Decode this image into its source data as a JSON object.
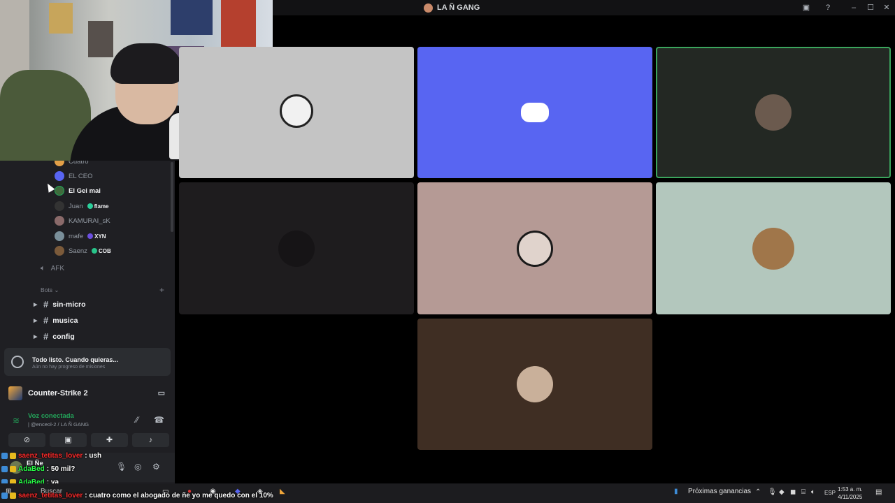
{
  "window": {
    "title": "LA Ñ GANG"
  },
  "sidebar": {
    "members": [
      {
        "name": "Cuatro",
        "color": "#e3a048"
      },
      {
        "name": "EL CEO",
        "color": "#5865f2"
      },
      {
        "name": "El Gei mai",
        "color": "#3f6a3c",
        "active": true
      },
      {
        "name": "Juan",
        "color": "#333333",
        "badge": "flame",
        "badge_color": "#2bcf9b"
      },
      {
        "name": "KAMURAI_sK",
        "color": "#8a6a6a"
      },
      {
        "name": "mafe",
        "color": "#7a8f9a",
        "badge": "XYN",
        "badge_color": "#6c4fe0"
      },
      {
        "name": "Saenz",
        "color": "#7b5a3a",
        "badge": "COB",
        "badge_color": "#28c48a"
      }
    ],
    "voice_channel": "AFK",
    "category": "Bots",
    "channels": [
      "sin-micro",
      "musica",
      "config"
    ],
    "quest": {
      "title": "Todo listo. Cuando quieras...",
      "subtitle": "Aún no hay progreso de misiones"
    },
    "game": "Counter-Strike 2",
    "voice": {
      "status": "Voz conectada",
      "path": "| @enceol-2 / LA Ñ GANG"
    },
    "user": {
      "name": "El Ñe"
    }
  },
  "chat": [
    {
      "user": "saenz_tetitas_lover",
      "message": ": ush",
      "user_color": "red"
    },
    {
      "user": "AdaBed",
      "message": ": 50 mil?",
      "user_color": "green"
    },
    {
      "user": "AdaBed",
      "message": ": va",
      "user_color": "green"
    },
    {
      "user": "saenz_tetitas_lover",
      "message": ": cuatro como el abogado de ñe yo me quedo con el 10%",
      "user_color": "red"
    }
  ],
  "tiles": [
    {
      "bg": "#c4c4c4",
      "icon": "grin-emoji-avatar"
    },
    {
      "bg": "#5865f2",
      "icon": "discord-logo-icon"
    },
    {
      "bg": "#232823",
      "icon": "user-avatar",
      "speaking": true,
      "speaking_color": "#3ba55d"
    },
    {
      "bg": "#1e1c1e",
      "icon": "user-avatar"
    },
    {
      "bg": "#b59a95",
      "icon": "user-avatar"
    },
    {
      "bg": "#b3c7bd",
      "icon": "bear-avatar"
    },
    {
      "bg": "#3f2e23",
      "icon": "user-avatar"
    }
  ],
  "taskbar": {
    "search": "Buscar",
    "widget": "Próximas ganancias",
    "lang": "ESP",
    "time": "1:53 a. m.",
    "date": "4/11/2025"
  }
}
